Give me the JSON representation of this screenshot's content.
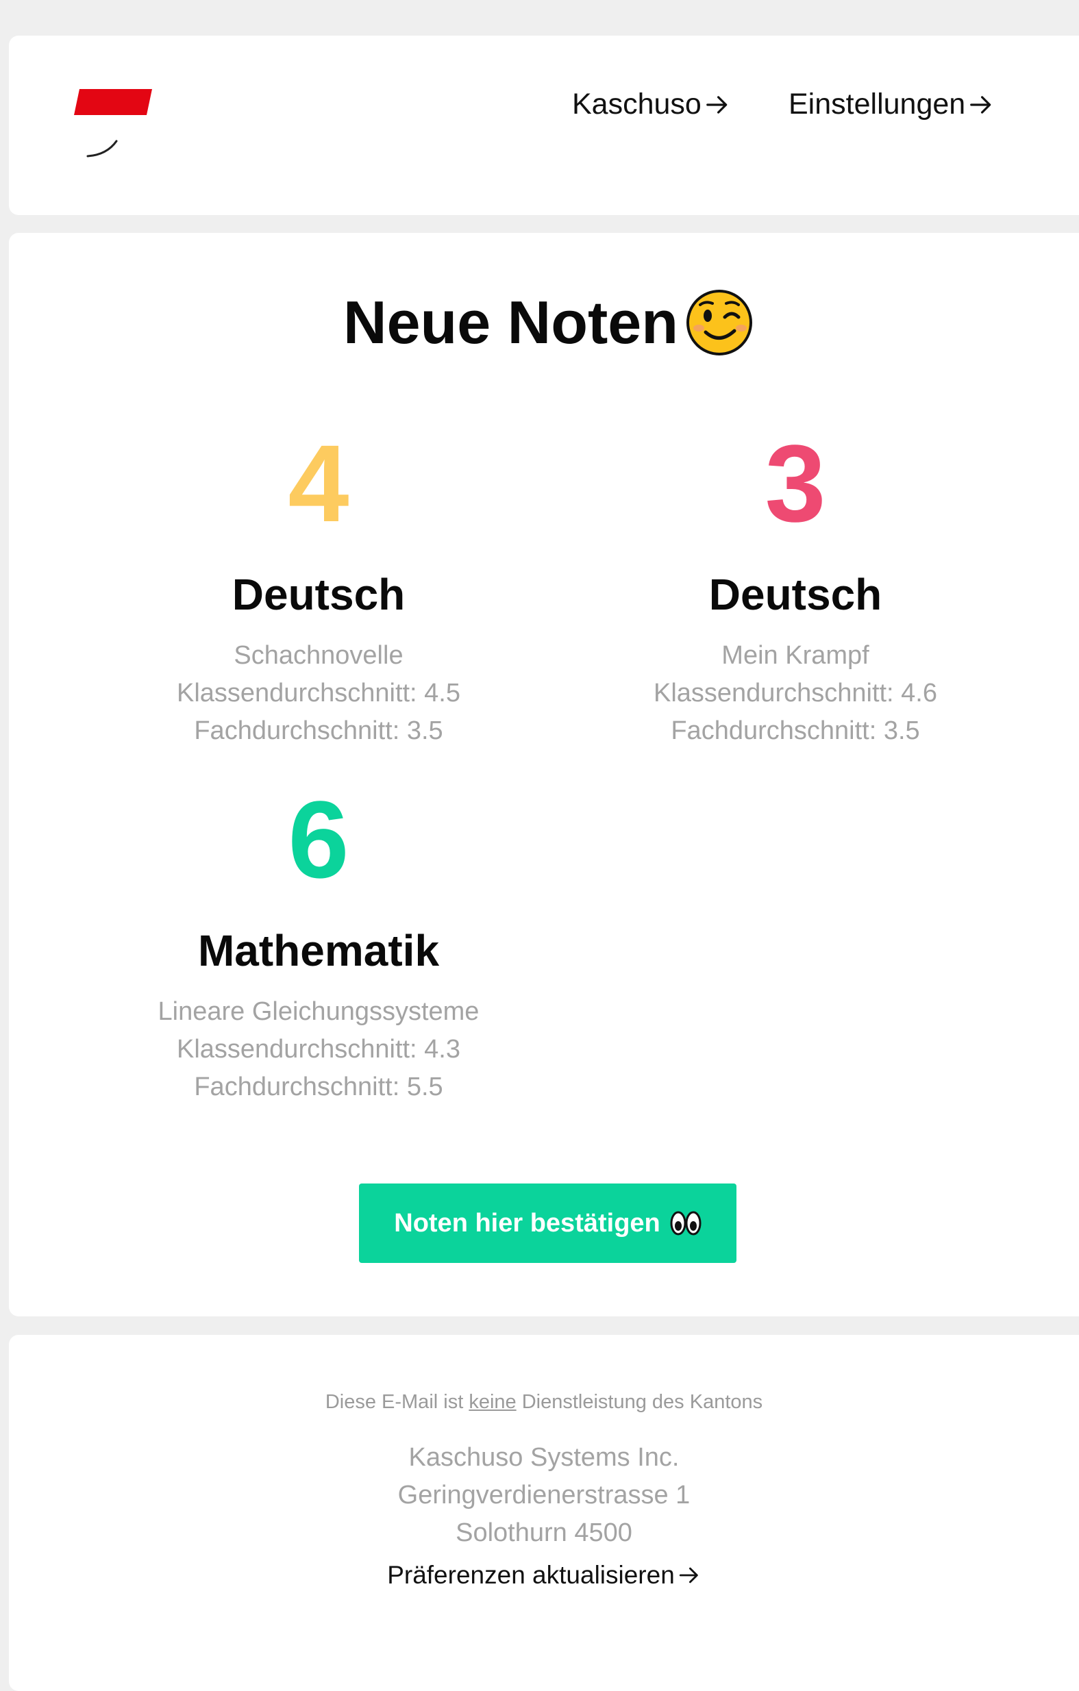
{
  "colors": {
    "grade_4": "#fdcb5f",
    "grade_3": "#ee4a72",
    "grade_6": "#0bd39b",
    "button": "#0bd39b",
    "logo_red": "#e30613"
  },
  "header": {
    "logo": "kaschuso-logo",
    "nav": [
      {
        "label": "Kaschuso",
        "icon": "arrow-right-icon"
      },
      {
        "label": "Einstellungen",
        "icon": "arrow-right-icon"
      }
    ]
  },
  "main": {
    "title": "Neue Noten",
    "title_icon": "winking-face-icon",
    "grades": [
      {
        "grade": "4",
        "subject": "Deutsch",
        "topic": "Schachnovelle",
        "class_avg": "Klassendurchschnitt: 4.5",
        "subject_avg": "Fachdurchschnitt: 3.5"
      },
      {
        "grade": "3",
        "subject": "Deutsch",
        "topic": "Mein Krampf",
        "class_avg": "Klassendurchschnitt: 4.6",
        "subject_avg": "Fachdurchschnitt: 3.5"
      },
      {
        "grade": "6",
        "subject": "Mathematik",
        "topic": "Lineare Gleichungssysteme",
        "class_avg": "Klassendurchschnitt: 4.3",
        "subject_avg": "Fachdurchschnitt: 5.5"
      }
    ],
    "confirm_button": {
      "label": "Noten hier bestätigen",
      "icon": "eyes-icon"
    }
  },
  "footer": {
    "note_before": "Diese E-Mail ist ",
    "note_link": "keine",
    "note_after": " Dienstleistung des Kantons",
    "address": [
      "Kaschuso Systems Inc.",
      "Geringverdienerstrasse 1",
      "Solothurn 4500"
    ],
    "preferences_link": "Präferenzen aktualisieren"
  }
}
